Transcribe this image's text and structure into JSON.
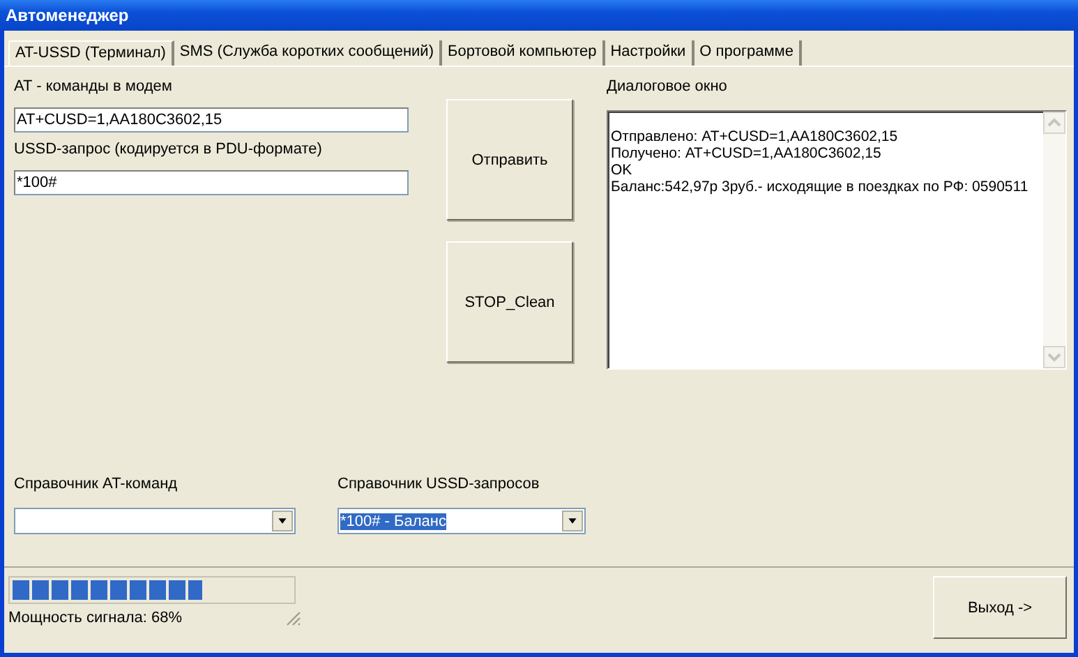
{
  "window": {
    "title": "Автоменеджер"
  },
  "tabs": [
    {
      "label": "AT-USSD (Терминал)",
      "selected": true
    },
    {
      "label": "SMS (Служба коротких сообщений)",
      "selected": false
    },
    {
      "label": "Бортовой компьютер",
      "selected": false
    },
    {
      "label": "Настройки",
      "selected": false
    },
    {
      "label": "О программе",
      "selected": false
    }
  ],
  "at_commands": {
    "label": "AT - команды в модем",
    "value": "AT+CUSD=1,AA180C3602,15"
  },
  "ussd_request": {
    "label": "USSD-запрос (кодируется в PDU-формате)",
    "value": "*100#"
  },
  "buttons": [
    {
      "label": "Отправить"
    },
    {
      "label": "STOP_Clean"
    }
  ],
  "dialog": {
    "label": "Диалоговое окно",
    "lines": [
      "Отправлено: AT+CUSD=1,AA180C3602,15",
      "Получено: AT+CUSD=1,AA180C3602,15",
      "OK",
      "Баланс:542,97р 3руб.- исходящие в поездках по РФ: 0590511"
    ]
  },
  "combos": [
    {
      "label": "Справочник AT-команд"
    },
    {
      "label": "Справочник USSD-запросов",
      "value": "*100# - Баланс",
      "focused": true
    }
  ],
  "status_bar": {
    "signal": {
      "level": 0.68
    },
    "signal_label": "Мощность сигнала: 68%",
    "exit_button": "Выход ->"
  }
}
